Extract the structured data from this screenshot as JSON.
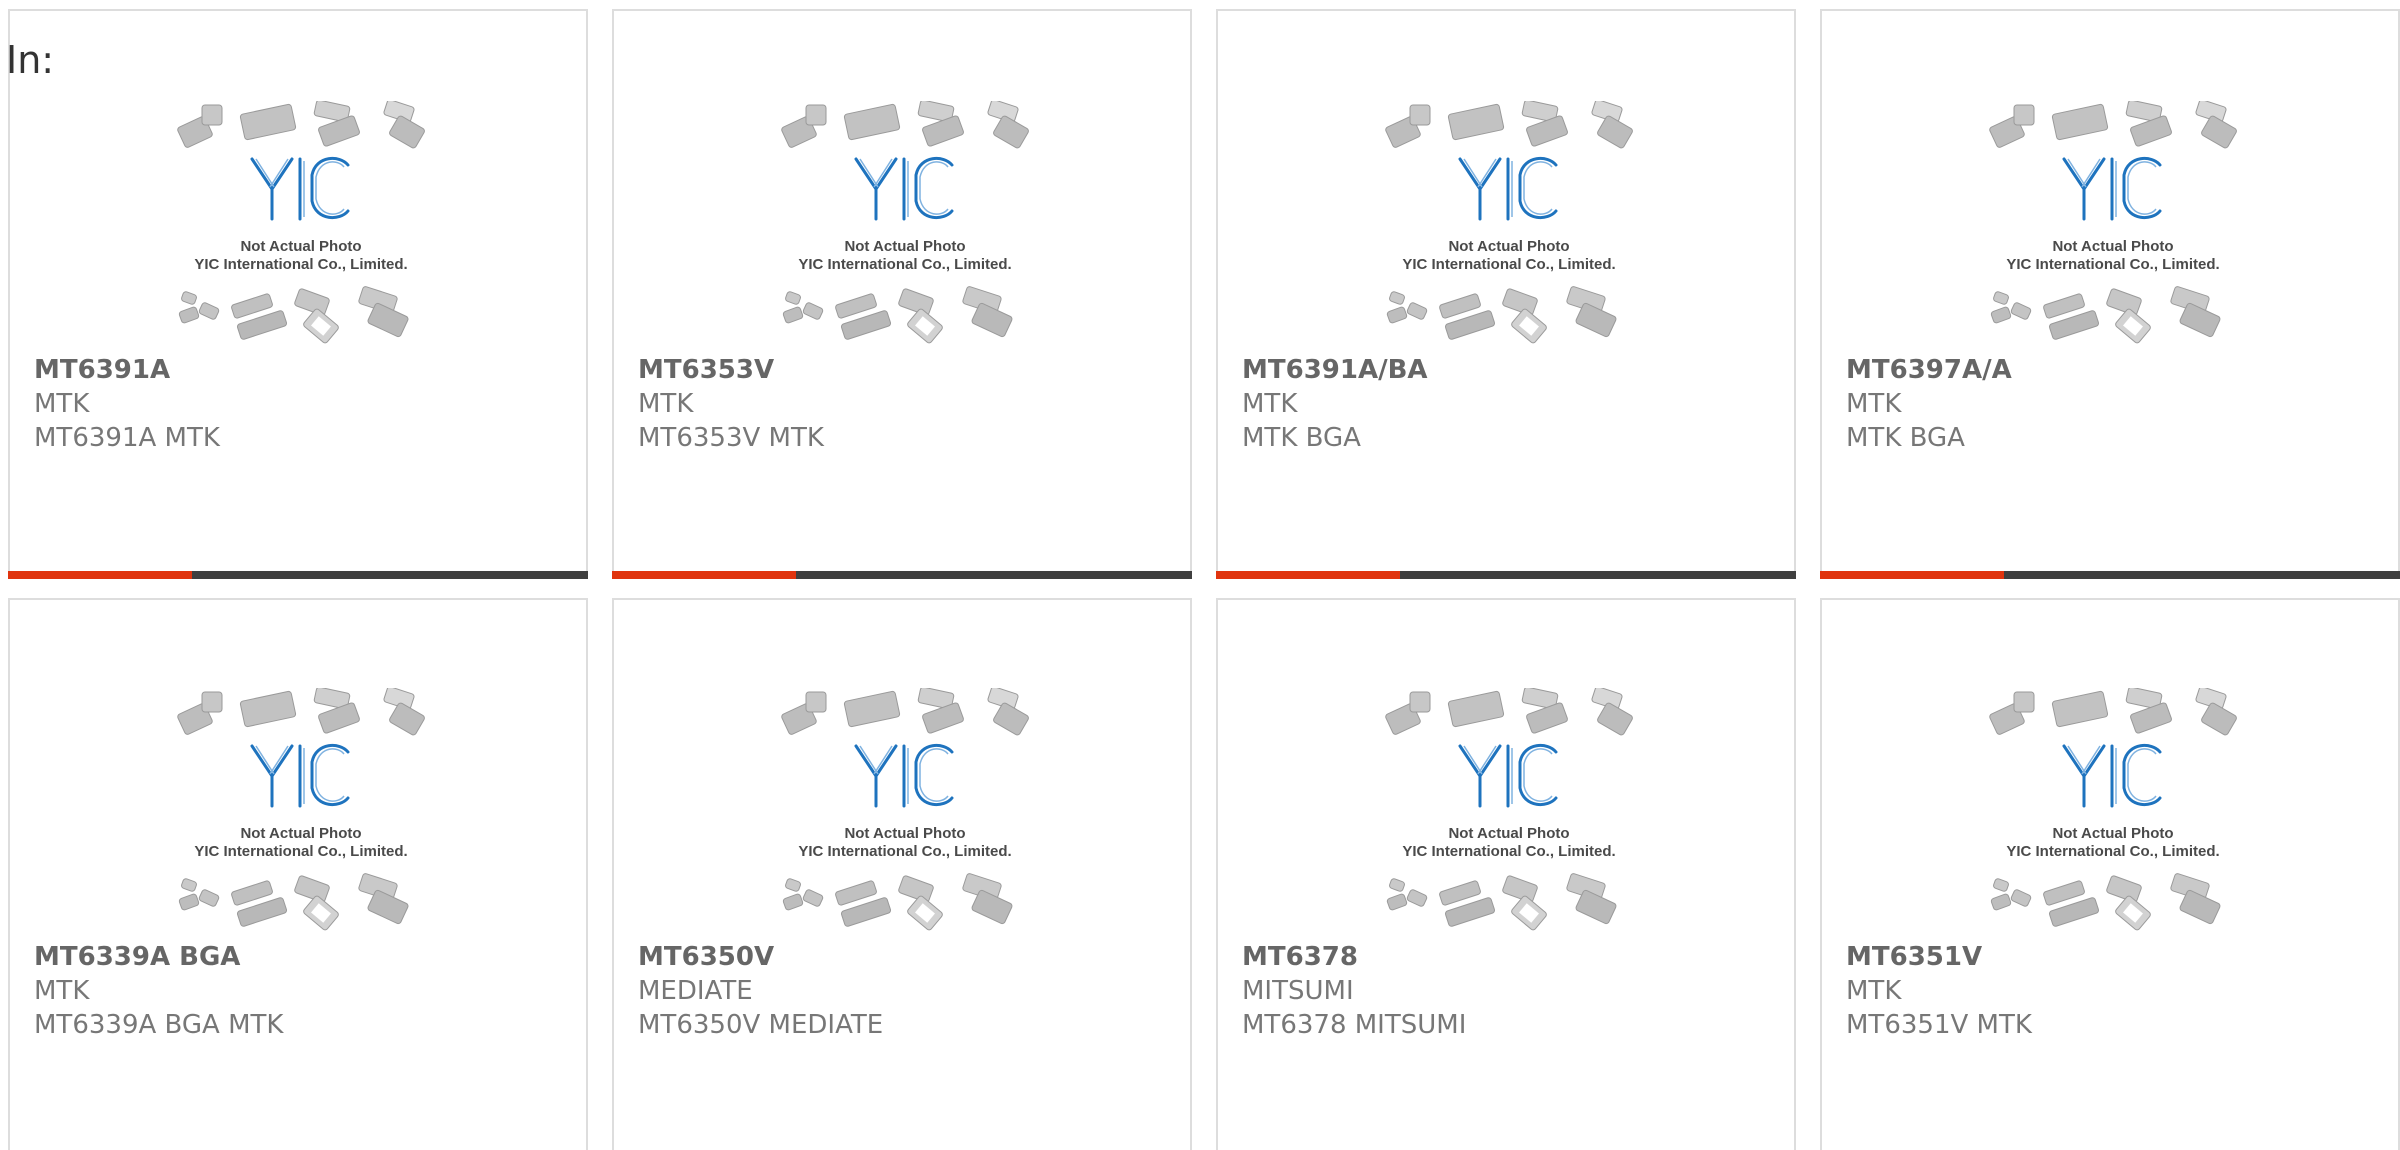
{
  "heading": "In:",
  "colors": {
    "accent": "#e0340e",
    "bar": "#3f3f3f",
    "border": "#dddddd",
    "logo_blue": "#1e73be"
  },
  "placeholder_photo": {
    "icon": "yic-logo-icon",
    "logo_text": "YIC",
    "line1": "Not Actual Photo",
    "line2": "YIC International Co., Limited."
  },
  "products": [
    {
      "part": "MT6391A",
      "manufacturer": "MTK",
      "description": "MT6391A MTK"
    },
    {
      "part": "MT6353V",
      "manufacturer": "MTK",
      "description": "MT6353V MTK"
    },
    {
      "part": "MT6391A/BA",
      "manufacturer": "MTK",
      "description": "MTK BGA"
    },
    {
      "part": "MT6397A/A",
      "manufacturer": "MTK",
      "description": "MTK BGA"
    },
    {
      "part": "MT6339A BGA",
      "manufacturer": "MTK",
      "description": "MT6339A BGA MTK"
    },
    {
      "part": "MT6350V",
      "manufacturer": "MEDIATE",
      "description": "MT6350V MEDIATE"
    },
    {
      "part": "MT6378",
      "manufacturer": "MITSUMI",
      "description": "MT6378 MITSUMI"
    },
    {
      "part": "MT6351V",
      "manufacturer": "MTK",
      "description": "MT6351V MTK"
    }
  ]
}
